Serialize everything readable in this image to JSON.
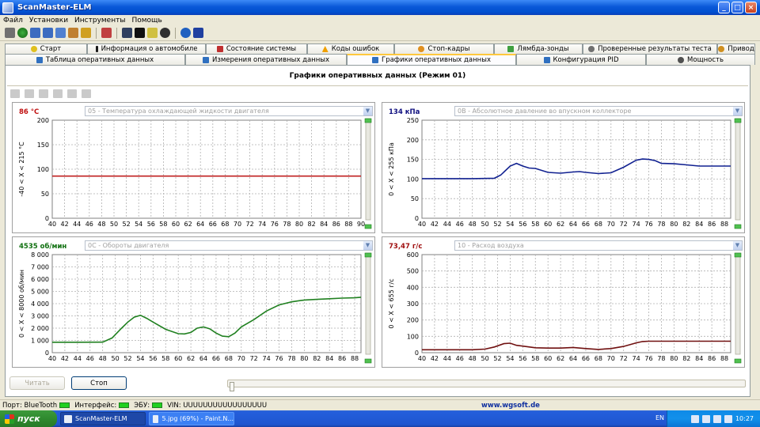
{
  "window": {
    "title": "ScanMaster-ELM",
    "minimize": "_",
    "maximize": "□",
    "close": "×"
  },
  "menu": [
    "Файл",
    "Установки",
    "Инструменты",
    "Помощь"
  ],
  "tabs_row1": [
    {
      "label": "Старт",
      "icon": "start-icon",
      "color": "#e0c020"
    },
    {
      "label": "Информация о автомобиле",
      "icon": "info-icon",
      "color": "#1a1a1a"
    },
    {
      "label": "Состояние системы",
      "icon": "system-status-icon",
      "color": "#c03030"
    },
    {
      "label": "Коды ошибок",
      "icon": "warning-icon",
      "color": "#f0a000"
    },
    {
      "label": "Стоп-кадры",
      "icon": "freeze-frame-icon",
      "color": "#e09020"
    },
    {
      "label": "Лямбда-зонды",
      "icon": "lambda-sensor-icon",
      "color": "#40a040"
    },
    {
      "label": "Проверенные результаты теста",
      "icon": "test-results-icon",
      "color": "#707070"
    },
    {
      "label": "Привод",
      "icon": "drive-icon",
      "color": "#d09020"
    }
  ],
  "tabs_row2": [
    {
      "label": "Таблица оперативных данных",
      "icon": "table-icon",
      "color": "#3070c0"
    },
    {
      "label": "Измерения оперативных данных",
      "icon": "measure-icon",
      "color": "#3070c0"
    },
    {
      "label": "Графики оперативных данных",
      "icon": "graph-icon",
      "color": "#3070c0",
      "active": true
    },
    {
      "label": "Конфигурация PID",
      "icon": "config-icon",
      "color": "#3070c0"
    },
    {
      "label": "Мощность",
      "icon": "power-icon",
      "color": "#505050"
    }
  ],
  "panel_title": "Графики оперативных данных (Режим 01)",
  "charts": [
    {
      "value": "86 °C",
      "value_color": "#c01010",
      "pid": "05 - Температура охлаждающей жидкости двигателя",
      "ylabel": "-40  < X <  215 °C",
      "line_color": "#c02020"
    },
    {
      "value": "134 кПа",
      "value_color": "#101080",
      "pid": "0B - Абсолютное давление во впускном коллекторе",
      "ylabel": "0  < X <  255 кПа",
      "line_color": "#102090"
    },
    {
      "value": "4535 об/мин",
      "value_color": "#107010",
      "pid": "0C - Обороты двигателя",
      "ylabel": "0  < X <  8000 об/мин",
      "line_color": "#208020"
    },
    {
      "value": "73,47 г/с",
      "value_color": "#a01010",
      "pid": "10 - Расход воздуха",
      "ylabel": "0  < X <  655 г/с",
      "line_color": "#701010"
    }
  ],
  "chart_data": [
    {
      "type": "line",
      "ylim": [
        0,
        200
      ],
      "yticks": [
        "200",
        "150",
        "100",
        "50",
        "0"
      ],
      "xticks": [
        "40",
        "42",
        "44",
        "46",
        "48",
        "50",
        "52",
        "54",
        "56",
        "58",
        "60",
        "62",
        "64",
        "66",
        "68",
        "70",
        "72",
        "74",
        "76",
        "78",
        "80",
        "82",
        "84",
        "86",
        "88",
        "90"
      ],
      "xlim": [
        40,
        90
      ],
      "x": [
        40,
        90
      ],
      "y": [
        86,
        86
      ]
    },
    {
      "type": "line",
      "ylim": [
        0,
        250
      ],
      "yticks": [
        "250",
        "200",
        "150",
        "100",
        "50",
        "0"
      ],
      "xticks": [
        "40",
        "42",
        "44",
        "46",
        "48",
        "50",
        "52",
        "54",
        "56",
        "58",
        "60",
        "62",
        "64",
        "66",
        "68",
        "70",
        "72",
        "74",
        "76",
        "78",
        "80",
        "82",
        "84",
        "86",
        "88"
      ],
      "xlim": [
        40,
        89
      ],
      "x": [
        40,
        44,
        48,
        51.5,
        52.5,
        54,
        55,
        56,
        57,
        58,
        60,
        62,
        64,
        65,
        66,
        68,
        70,
        72,
        74,
        75,
        76,
        77,
        78,
        80,
        82,
        84,
        86,
        89
      ],
      "y": [
        101,
        101,
        101,
        102,
        110,
        133,
        140,
        133,
        128,
        127,
        117,
        115,
        118,
        119,
        117,
        114,
        116,
        130,
        148,
        151,
        150,
        147,
        140,
        139,
        136,
        133,
        133,
        133
      ]
    },
    {
      "type": "line",
      "ylim": [
        0,
        8000
      ],
      "yticks": [
        "8 000",
        "7 000",
        "6 000",
        "5 000",
        "4 000",
        "3 000",
        "2 000",
        "1 000",
        "0"
      ],
      "xticks": [
        "40",
        "42",
        "44",
        "46",
        "48",
        "50",
        "52",
        "54",
        "56",
        "58",
        "60",
        "62",
        "64",
        "66",
        "68",
        "70",
        "72",
        "74",
        "76",
        "78",
        "80",
        "82",
        "84",
        "86",
        "88"
      ],
      "xlim": [
        40,
        89
      ],
      "x": [
        40,
        44,
        48,
        49.5,
        51,
        52,
        53,
        54,
        55,
        56,
        58,
        60,
        61,
        62,
        63,
        64,
        65,
        66,
        67,
        68,
        69,
        70,
        72,
        74,
        76,
        78,
        80,
        82,
        84,
        86,
        88,
        89
      ],
      "y": [
        850,
        850,
        860,
        1200,
        2000,
        2500,
        2900,
        3050,
        2800,
        2500,
        1900,
        1550,
        1530,
        1650,
        2000,
        2100,
        1950,
        1600,
        1350,
        1300,
        1600,
        2100,
        2700,
        3400,
        3900,
        4150,
        4300,
        4350,
        4400,
        4450,
        4480,
        4520
      ]
    },
    {
      "type": "line",
      "ylim": [
        0,
        600
      ],
      "yticks": [
        "600",
        "500",
        "400",
        "300",
        "200",
        "100",
        "0"
      ],
      "xticks": [
        "40",
        "42",
        "44",
        "46",
        "48",
        "50",
        "52",
        "54",
        "56",
        "58",
        "60",
        "62",
        "64",
        "66",
        "68",
        "70",
        "72",
        "74",
        "76",
        "78",
        "80",
        "82",
        "84",
        "86",
        "88"
      ],
      "xlim": [
        40,
        89
      ],
      "x": [
        40,
        44,
        48,
        50,
        51.5,
        53,
        54,
        55,
        56,
        58,
        60,
        62,
        64,
        66,
        68,
        70,
        72,
        74,
        75,
        76,
        78,
        80,
        84,
        89
      ],
      "y": [
        18,
        18,
        18,
        22,
        35,
        55,
        58,
        45,
        40,
        30,
        28,
        28,
        32,
        25,
        20,
        25,
        38,
        60,
        68,
        70,
        70,
        70,
        70,
        70
      ]
    }
  ],
  "buttons": {
    "read": "Читать",
    "stop": "Стоп"
  },
  "status": {
    "port_label": "Порт: BlueTooth",
    "iface_label": "Интерфейс:",
    "ecu_label": "ЭБУ:",
    "vin_label": "VIN: UUUUUUUUUUUUUUUUU",
    "url": "www.wgsoft.de"
  },
  "taskbar": {
    "start": "пуск",
    "items": [
      "ScanMaster-ELM",
      "5.jpg (69%) - Paint.N..."
    ],
    "lang": "EN",
    "time": "10:27"
  }
}
